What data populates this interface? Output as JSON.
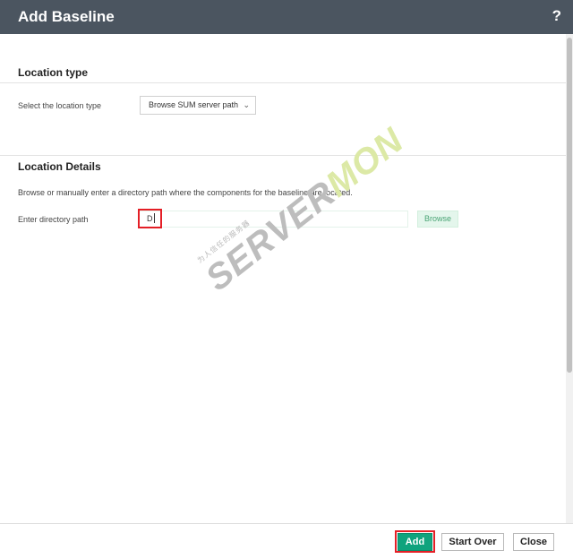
{
  "dialog": {
    "title": "Add Baseline",
    "help_label": "?"
  },
  "location_type": {
    "section_title": "Location type",
    "field_label": "Select the location type",
    "selected_value": "Browse SUM server path",
    "chevron": "chevron-down-icon"
  },
  "location_details": {
    "section_title": "Location Details",
    "description": "Browse or manually enter a directory path where the components for the baseline are located.",
    "path_label": "Enter directory path",
    "path_value": "D",
    "browse_label": "Browse"
  },
  "watermark": {
    "small_text": "为人信任的服务器",
    "big_text_a": "SERVER",
    "big_text_b": "MON"
  },
  "footer": {
    "add_label": "Add",
    "start_over_label": "Start Over",
    "close_label": "Close"
  },
  "colors": {
    "titlebar": "#4b5560",
    "primary_button": "#0fa37d",
    "highlight": "#e41f26",
    "browse_text": "#4aa475"
  }
}
